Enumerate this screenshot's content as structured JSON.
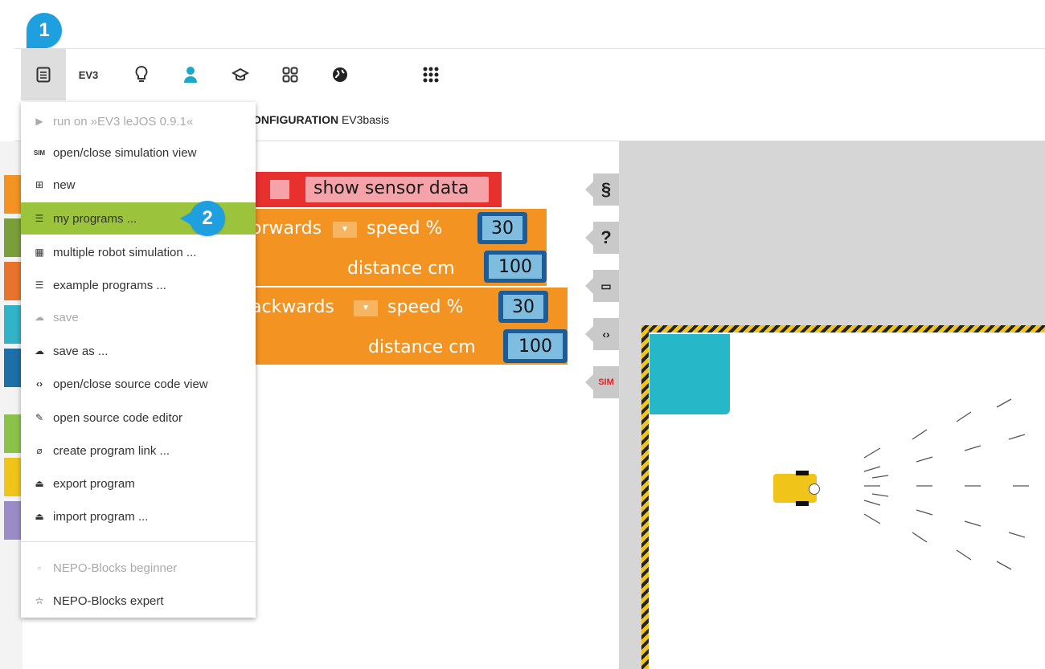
{
  "callouts": {
    "first": "1",
    "second": "2"
  },
  "toolbar": {
    "robot_label": "EV3",
    "icons": [
      "program-menu-icon",
      "ev3-robot",
      "lightbulb-icon",
      "user-icon",
      "graduation-cap-icon",
      "gallery-icon",
      "globe-icon",
      "apps-grid-icon"
    ]
  },
  "config_bar": {
    "label_bold": "ONFIGURATION",
    "label": "EV3basis"
  },
  "menu": {
    "items": [
      {
        "icon": "▶",
        "label": "run on »EV3 leJOS 0.9.1«",
        "disabled": true
      },
      {
        "icon": "SIM",
        "label": "open/close simulation view",
        "disabled": false
      },
      {
        "icon": "⊞",
        "label": "new",
        "disabled": false
      },
      {
        "icon": "☰",
        "label": "my programs ...",
        "disabled": false,
        "highlighted": true
      },
      {
        "icon": "▦",
        "label": "multiple robot simulation ...",
        "disabled": false
      },
      {
        "icon": "☰",
        "label": "example programs ...",
        "disabled": false
      },
      {
        "icon": "☁",
        "label": "save",
        "disabled": true
      },
      {
        "icon": "☁",
        "label": "save as ...",
        "disabled": false
      },
      {
        "icon": "‹›",
        "label": "open/close source code view",
        "disabled": false
      },
      {
        "icon": "✎",
        "label": "open source code editor",
        "disabled": false
      },
      {
        "icon": "⌀",
        "label": "create program link ...",
        "disabled": false
      },
      {
        "icon": "⏏",
        "label": "export program",
        "disabled": false
      },
      {
        "icon": "⏏",
        "label": "import program ...",
        "disabled": false
      },
      {
        "icon": "▫",
        "label": "NEPO-Blocks beginner",
        "disabled": true
      },
      {
        "icon": "☆",
        "label": "NEPO-Blocks expert",
        "disabled": false
      }
    ]
  },
  "blocks": {
    "sensor": "show sensor data",
    "forward_dir": "orwards",
    "backward_dir": "ackwards",
    "speed": "speed %",
    "distance": "distance cm",
    "speed_value_1": "30",
    "distance_value_1": "100",
    "speed_value_2": "30",
    "distance_value_2": "100"
  },
  "side_tabs": [
    "§",
    "?",
    "▭",
    "‹›",
    "SIM"
  ],
  "colors": {
    "accent": "#1e9fe0",
    "highlight": "#9cc33c",
    "block_orange": "#f29322",
    "block_red": "#e8302f",
    "num_blue": "#1c5d99",
    "sim_cyan": "#26b7c8"
  }
}
